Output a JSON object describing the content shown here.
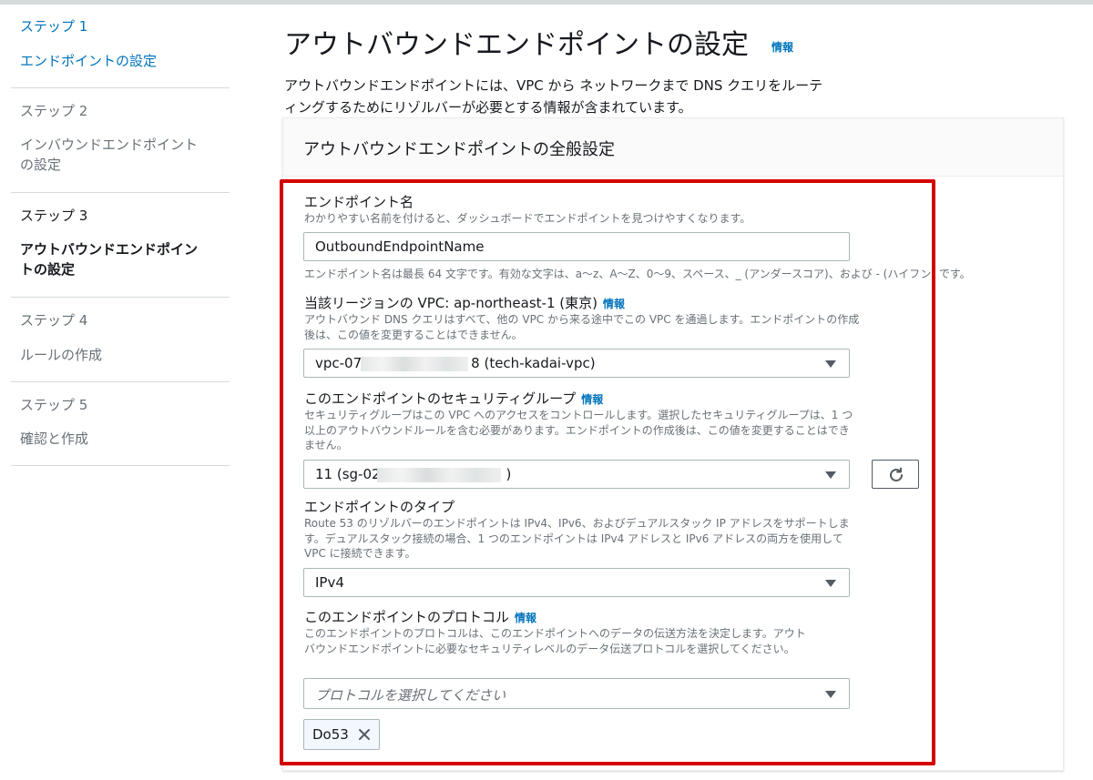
{
  "sidebar": {
    "steps": [
      {
        "number": "ステップ 1",
        "title": "エンドポイントの設定"
      },
      {
        "number": "ステップ 2",
        "title": "インバウンドエンドポイントの設定"
      },
      {
        "number": "ステップ 3",
        "title": "アウトバウンドエンドポイントの設定"
      },
      {
        "number": "ステップ 4",
        "title": "ルールの作成"
      },
      {
        "number": "ステップ 5",
        "title": "確認と作成"
      }
    ]
  },
  "page": {
    "title": "アウトバウンドエンドポイントの設定",
    "info": "情報",
    "description": "アウトバウンドエンドポイントには、VPC から ネットワークまで DNS クエリをルーティングするためにリゾルバーが必要とする情報が含まれています。"
  },
  "panel": {
    "title": "アウトバウンドエンドポイントの全般設定",
    "endpoint_name": {
      "label": "エンドポイント名",
      "description": "わかりやすい名前を付けると、ダッシュボードでエンドポイントを見つけやすくなります。",
      "value": "OutboundEndpointName",
      "constraint": "エンドポイント名は最長 64 文字です。有効な文字は、a〜z、A〜Z、0〜9、スペース、_ (アンダースコア)、および - (ハイフン) です。"
    },
    "vpc": {
      "label": "当該リージョンの VPC: ap-northeast-1 (東京)",
      "info": "情報",
      "description": "アウトバウンド DNS クエリはすべて、他の VPC から来る途中でこの VPC を通過します。エンドポイントの作成後は、この値を変更することはできません。",
      "value_prefix": "vpc-07",
      "value_suffix": "8 (tech-kadai-vpc)"
    },
    "security_group": {
      "label": "このエンドポイントのセキュリティグループ",
      "info": "情報",
      "description": "セキュリティグループはこの VPC へのアクセスをコントロールします。選択したセキュリティグループは、1 つ以上のアウトバウンドルールを含む必要があります。エンドポイントの作成後は、この値を変更することはできません。",
      "value_prefix": "11 (sg-02",
      "value_suffix": ")"
    },
    "endpoint_type": {
      "label": "エンドポイントのタイプ",
      "description": "Route 53 のリゾルバーのエンドポイントは IPv4、IPv6、およびデュアルスタック IP アドレスをサポートします。デュアルスタック接続の場合、1 つのエンドポイントは IPv4 アドレスと IPv6 アドレスの両方を使用して VPC に接続できます。",
      "value": "IPv4"
    },
    "protocol": {
      "label": "このエンドポイントのプロトコル",
      "info": "情報",
      "description": "このエンドポイントのプロトコルは、このエンドポイントへのデータの伝送方法を決定します。アウトバウンドエンドポイントに必要なセキュリティレベルのデータ伝送プロトコルを選択してください。",
      "placeholder": "プロトコルを選択してください",
      "selected_token": "Do53"
    }
  },
  "icons": {
    "refresh": "refresh-icon",
    "caret": "caret-down-icon",
    "remove": "close-icon"
  },
  "colors": {
    "link": "#0073bb",
    "highlight_border": "#d40000",
    "muted_text": "#687078"
  }
}
